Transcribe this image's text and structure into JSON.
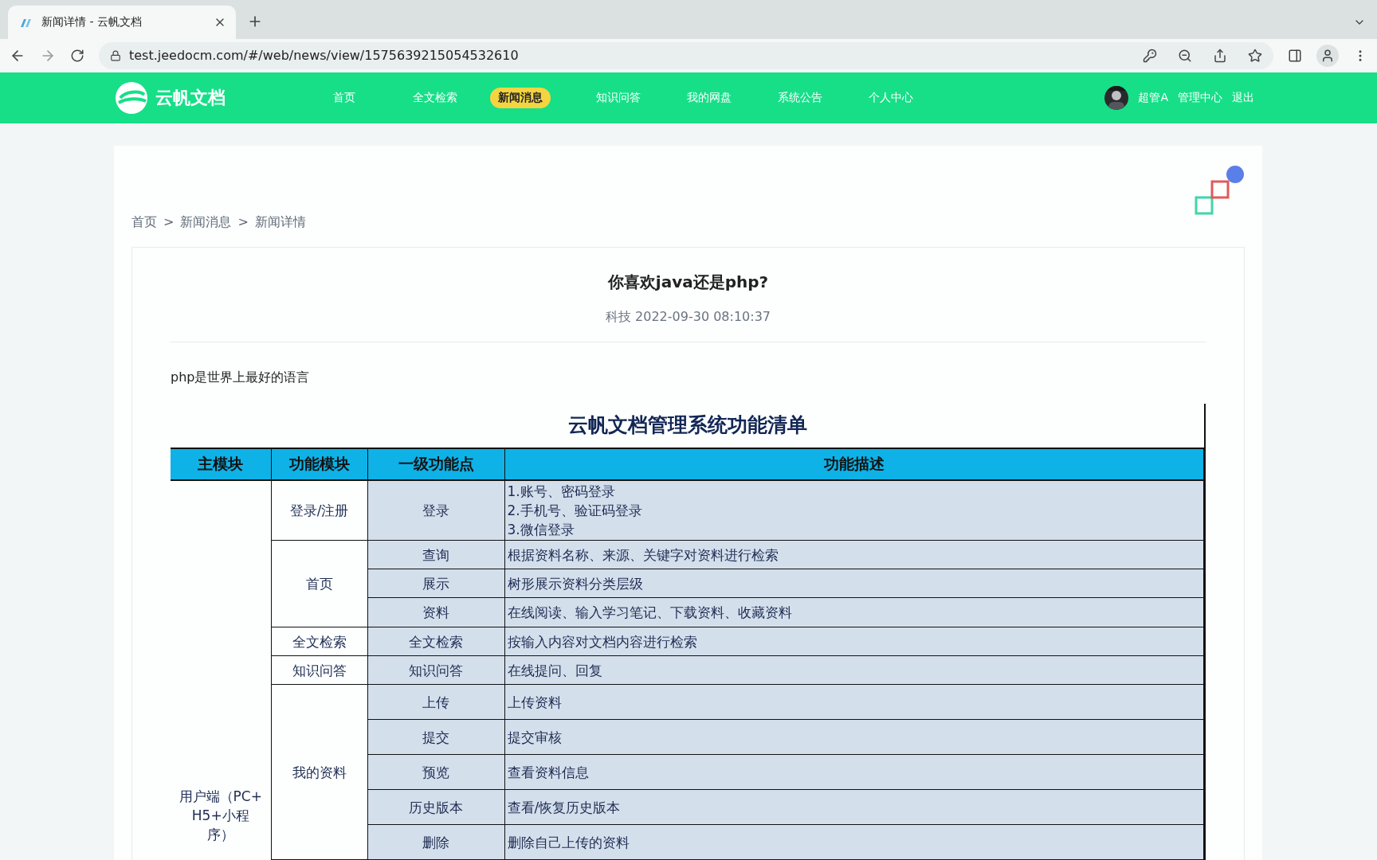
{
  "browser": {
    "tab_title": "新闻详情 - 云帆文档",
    "url": "test.jeedocm.com/#/web/news/view/1575639215054532610"
  },
  "site": {
    "logo_text": "云帆文档",
    "nav": [
      {
        "label": "首页",
        "selected": false
      },
      {
        "label": "全文检索",
        "selected": false
      },
      {
        "label": "新闻消息",
        "selected": true
      },
      {
        "label": "知识问答",
        "selected": false
      },
      {
        "label": "我的网盘",
        "selected": false
      },
      {
        "label": "系统公告",
        "selected": false
      },
      {
        "label": "个人中心",
        "selected": false
      }
    ],
    "user": {
      "name": "超管A",
      "links": [
        "管理中心",
        "退出"
      ]
    }
  },
  "breadcrumb": [
    "首页",
    "新闻消息",
    "新闻详情"
  ],
  "breadcrumb_separator": ">",
  "article": {
    "title": "你喜欢java还是php?",
    "category": "科技",
    "date": "2022-09-30 08:10:37",
    "body": "php是世界上最好的语言",
    "table": {
      "title": "云帆文档管理系统功能清单",
      "columns": [
        "主模块",
        "功能模块",
        "一级功能点",
        "功能描述"
      ],
      "groups": [
        {
          "main_module": "用户端（PC+H5+小程序）",
          "modules": [
            {
              "name": "登录/注册",
              "features": [
                {
                  "name": "登录",
                  "description": [
                    "1.账号、密码登录",
                    "2.手机号、验证码登录",
                    "3.微信登录"
                  ]
                }
              ]
            },
            {
              "name": "首页",
              "features": [
                {
                  "name": "查询",
                  "description": [
                    "根据资料名称、来源、关键字对资料进行检索"
                  ]
                },
                {
                  "name": "展示",
                  "description": [
                    "树形展示资料分类层级"
                  ]
                },
                {
                  "name": "资料",
                  "description": [
                    "在线阅读、输入学习笔记、下载资料、收藏资料"
                  ]
                }
              ]
            },
            {
              "name": "全文检索",
              "features": [
                {
                  "name": "全文检索",
                  "description": [
                    "按输入内容对文档内容进行检索"
                  ]
                }
              ]
            },
            {
              "name": "知识问答",
              "features": [
                {
                  "name": "知识问答",
                  "description": [
                    "在线提问、回复"
                  ]
                }
              ]
            },
            {
              "name": "我的资料",
              "features": [
                {
                  "name": "上传",
                  "description": [
                    "上传资料"
                  ]
                },
                {
                  "name": "提交",
                  "description": [
                    "提交审核"
                  ]
                },
                {
                  "name": "预览",
                  "description": [
                    "查看资料信息"
                  ]
                },
                {
                  "name": "历史版本",
                  "description": [
                    "查看/恢复历史版本"
                  ]
                },
                {
                  "name": "删除",
                  "description": [
                    "删除自己上传的资料"
                  ]
                }
              ]
            }
          ]
        }
      ]
    }
  }
}
